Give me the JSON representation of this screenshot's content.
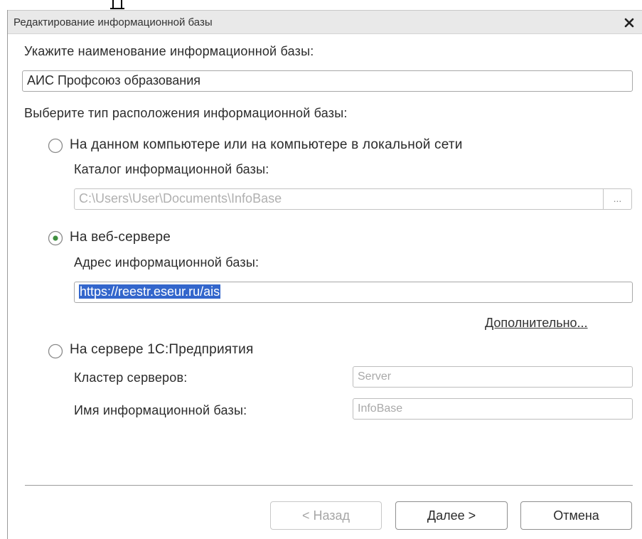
{
  "window": {
    "title": "Редактирование информационной базы"
  },
  "form": {
    "name_label": "Укажите наименование информационной базы:",
    "name_value": "АИС Профсоюз образования",
    "location_label": "Выберите тип расположения информационной базы:"
  },
  "options": {
    "local": {
      "label": "На данном компьютере или на компьютере в локальной сети",
      "selected": false,
      "catalog_label": "Каталог информационной базы:",
      "catalog_value": "C:\\Users\\User\\Documents\\InfoBase",
      "browse_label": "..."
    },
    "web": {
      "label": "На веб-сервере",
      "selected": true,
      "address_label": "Адрес информационной базы:",
      "address_value": "https://reestr.eseur.ru/ais",
      "more_link": "Дополнительно..."
    },
    "server": {
      "label": "На сервере 1С:Предприятия",
      "selected": false,
      "cluster_label": "Кластер серверов:",
      "cluster_value": "Server",
      "db_label": "Имя информационной базы:",
      "db_value": "InfoBase"
    }
  },
  "buttons": {
    "back": "< Назад",
    "next": "Далее >",
    "cancel": "Отмена"
  },
  "colors": {
    "accent_radio": "#3f8f3f",
    "selection": "#3366cc"
  }
}
